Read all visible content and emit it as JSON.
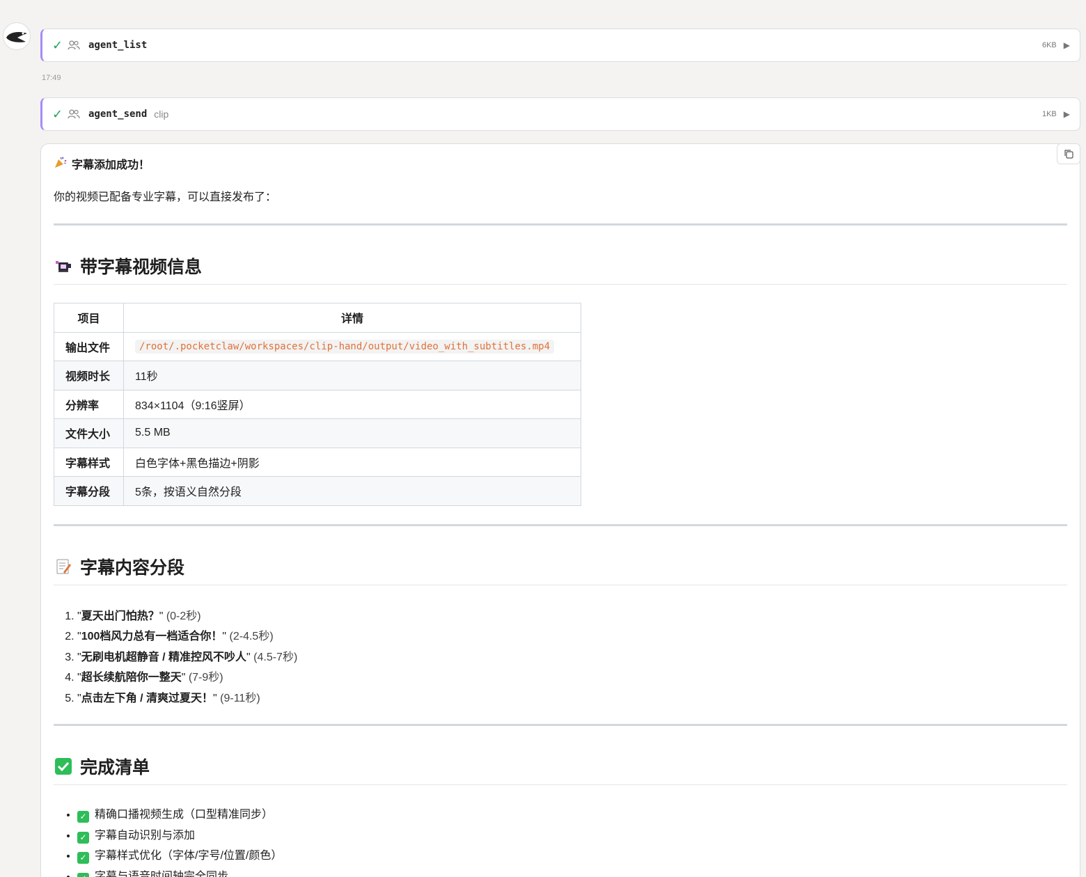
{
  "tools": [
    {
      "name": "agent_list",
      "arg": "",
      "size": "6KB"
    },
    {
      "name": "agent_send",
      "arg": "clip",
      "size": "1KB"
    }
  ],
  "timestamp": "17:49",
  "message": {
    "success_title": "字幕添加成功！",
    "intro": "你的视频已配备专业字幕，可以直接发布了：",
    "section1_title": "带字幕视频信息",
    "table": {
      "headers": [
        "项目",
        "详情"
      ],
      "rows": [
        {
          "key": "输出文件",
          "value": "/root/.pocketclaw/workspaces/clip-hand/output/video_with_subtitles.mp4"
        },
        {
          "key": "视频时长",
          "value": "11秒"
        },
        {
          "key": "分辨率",
          "value": "834×1104（9:16竖屏）"
        },
        {
          "key": "文件大小",
          "value": "5.5 MB"
        },
        {
          "key": "字幕样式",
          "value": "白色字体+黑色描边+阴影"
        },
        {
          "key": "字幕分段",
          "value": "5条，按语义自然分段"
        }
      ]
    },
    "section2_title": "字幕内容分段",
    "segments": [
      {
        "text": "夏天出门怕热？",
        "time": "(0-2秒)"
      },
      {
        "text": "100档风力总有一档适合你！",
        "time": "(2-4.5秒)"
      },
      {
        "text": "无刷电机超静音 / 精准控风不吵人",
        "time": "(4.5-7秒)"
      },
      {
        "text": "超长续航陪你一整天",
        "time": "(7-9秒)"
      },
      {
        "text": "点击左下角 / 清爽过夏天！",
        "time": "(9-11秒)"
      }
    ],
    "section3_title": "完成清单",
    "checklist": [
      "精确口播视频生成（口型精准同步）",
      "字幕自动识别与添加",
      "字幕样式优化（字体/字号/位置/颜色）",
      "字幕与语音时间轴完全同步"
    ]
  }
}
